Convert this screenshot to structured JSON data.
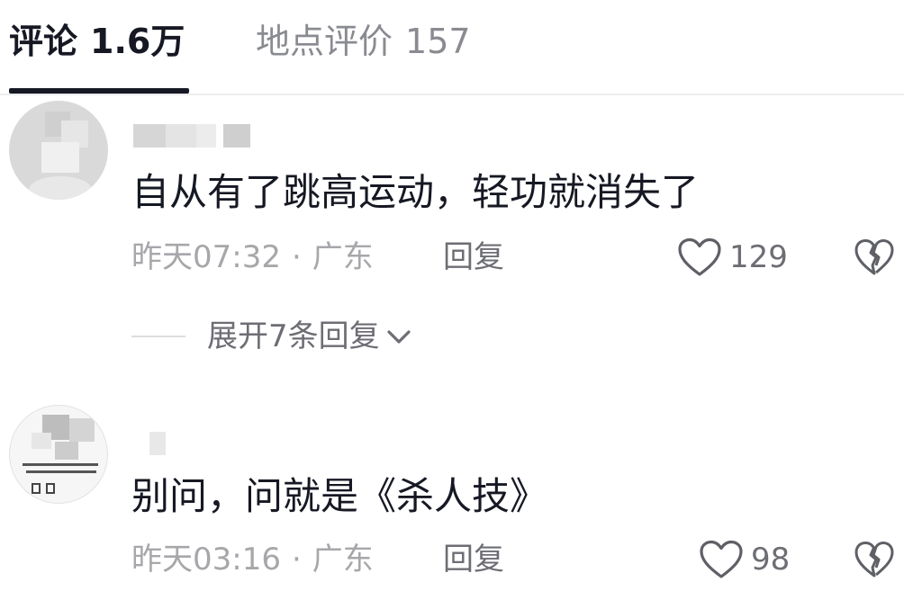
{
  "tabs": [
    {
      "label": "评论",
      "count": "1.6万",
      "active": true
    },
    {
      "label": "地点评价",
      "count": "157",
      "active": false
    }
  ],
  "comments": [
    {
      "text": "自从有了跳高运动，轻功就消失了",
      "time": "昨天07:32",
      "separator": "·",
      "location": "广东",
      "reply_label": "回复",
      "likes": "129",
      "expand_label": "展开7条回复"
    },
    {
      "text": "别问，问就是《杀人技》",
      "time": "昨天03:16",
      "separator": "·",
      "location": "广东",
      "reply_label": "回复",
      "likes": "98"
    }
  ],
  "icons": {
    "like": "heart-outline-icon",
    "dislike": "broken-heart-icon",
    "expand": "chevron-down-icon"
  },
  "colors": {
    "text_primary": "#161823",
    "text_secondary": "#a7a7ab",
    "action_text": "#6d6e74",
    "tab_inactive": "#8a8b91",
    "divider": "#ececec"
  }
}
